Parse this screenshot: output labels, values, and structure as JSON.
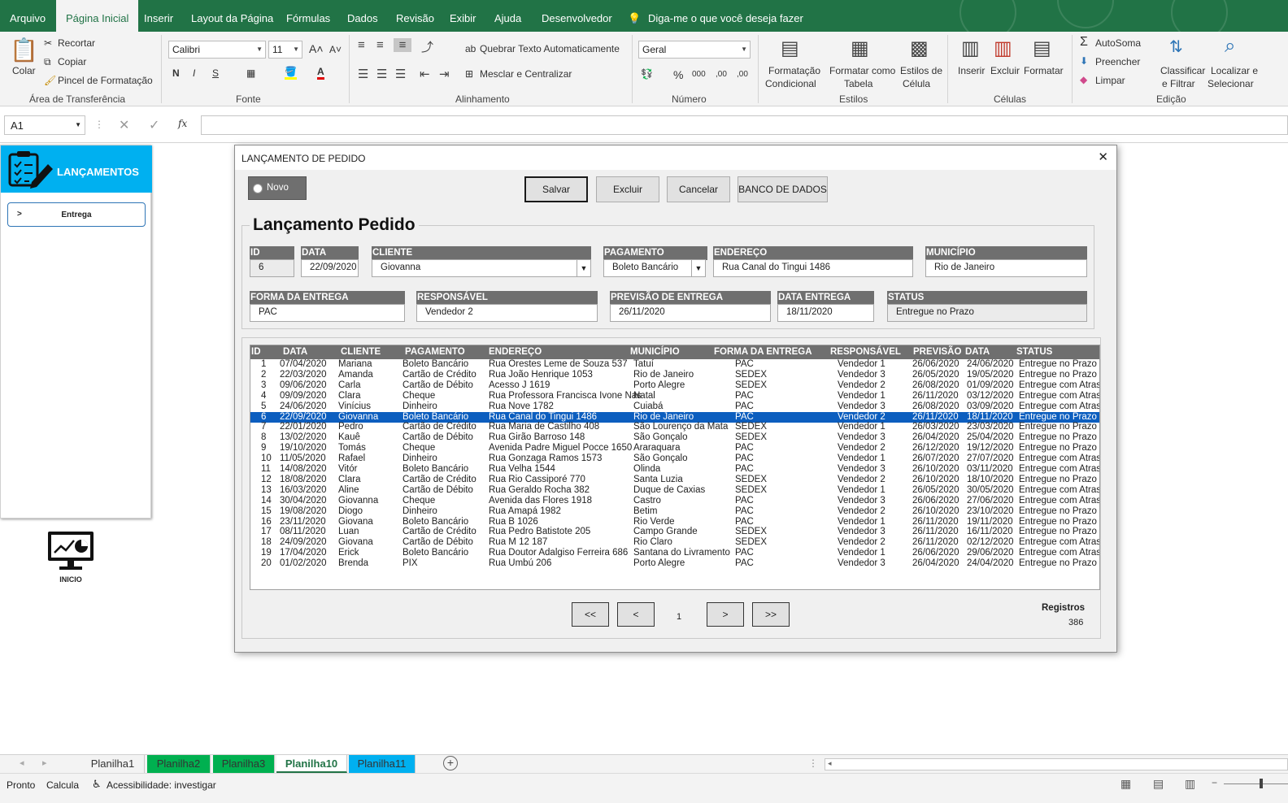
{
  "ribbon_tabs": [
    "Arquivo",
    "Página Inicial",
    "Inserir",
    "Layout da Página",
    "Fórmulas",
    "Dados",
    "Revisão",
    "Exibir",
    "Ajuda",
    "Desenvolvedor",
    "Diga-me o que você deseja fazer"
  ],
  "ribbon": {
    "clipboard": {
      "paste": "Colar",
      "cut": "Recortar",
      "copy": "Copiar",
      "format_painter": "Pincel de Formatação",
      "group": "Área de Transferência"
    },
    "font": {
      "name": "Calibri",
      "size": "11",
      "bold": "N",
      "italic": "I",
      "underline": "S",
      "group": "Fonte"
    },
    "alignment": {
      "wrap": "Quebrar Texto Automaticamente",
      "merge": "Mesclar e Centralizar",
      "group": "Alinhamento"
    },
    "number": {
      "format": "Geral",
      "percent": "%",
      "thousands": "000",
      "inc_dec": ",00",
      "dec_dec": ",00",
      "group": "Número"
    },
    "styles": {
      "conditional_1": "Formatação",
      "conditional_2": "Condicional",
      "format_table_1": "Formatar como",
      "format_table_2": "Tabela",
      "cell_styles_1": "Estilos de",
      "cell_styles_2": "Célula",
      "group": "Estilos"
    },
    "cells": {
      "insert": "Inserir",
      "delete": "Excluir",
      "format": "Formatar",
      "group": "Células"
    },
    "editing": {
      "autosum": "AutoSoma",
      "fill": "Preencher",
      "clear": "Limpar",
      "sort_1": "Classificar",
      "sort_2": "e Filtrar",
      "find_1": "Localizar e",
      "find_2": "Selecionar",
      "group": "Edição"
    }
  },
  "formula_bar": {
    "name_box": "A1",
    "fx": "fx",
    "value": ""
  },
  "side_panel": {
    "title": "LANÇAMENTOS",
    "button": "Entrega",
    "button_arrow": ">",
    "home_label": "INICIO"
  },
  "dialog": {
    "title": "LANÇAMENTO DE PEDIDO",
    "close": "✕",
    "new_option": "Novo",
    "buttons": {
      "save": "Salvar",
      "delete": "Excluir",
      "cancel": "Cancelar",
      "database": "BANCO DE DADOS"
    },
    "section_title": "Lançamento Pedido",
    "labels": {
      "id": "ID",
      "date": "DATA",
      "client": "CLIENTE",
      "payment": "PAGAMENTO",
      "address": "ENDEREÇO",
      "city": "MUNICÍPIO",
      "delivery": "FORMA DA ENTREGA",
      "responsible": "RESPONSÁVEL",
      "forecast": "PREVISÃO DE ENTREGA",
      "delivery_date": "DATA ENTREGA",
      "status": "STATUS"
    },
    "values": {
      "id": "6",
      "date": "22/09/2020",
      "client": "Giovanna",
      "payment": "Boleto Bancário",
      "address": "Rua Canal do Tingui 1486",
      "city": "Rio de Janeiro",
      "delivery": "PAC",
      "responsible": "Vendedor 2",
      "forecast": "26/11/2020",
      "delivery_date": "18/11/2020",
      "status": "Entregue no Prazo"
    },
    "list_headers": [
      "ID",
      "DATA",
      "CLIENTE",
      "PAGAMENTO",
      "ENDEREÇO",
      "MUNICÍPIO",
      "FORMA DA ENTREGA",
      "RESPONSÁVEL",
      "PREVISÃO",
      "DATA",
      "STATUS"
    ],
    "rows": [
      [
        "1",
        "07/04/2020",
        "Mariana",
        "Boleto Bancário",
        "Rua Orestes Leme de Souza 537",
        "Tatuí",
        "PAC",
        "Vendedor 1",
        "26/06/2020",
        "24/06/2020",
        "Entregue no Prazo"
      ],
      [
        "2",
        "22/03/2020",
        "Amanda",
        "Cartão de Crédito",
        "Rua João Henrique 1053",
        "Rio de Janeiro",
        "SEDEX",
        "Vendedor 3",
        "26/05/2020",
        "19/05/2020",
        "Entregue no Prazo"
      ],
      [
        "3",
        "09/06/2020",
        "Carla",
        "Cartão de Débito",
        "Acesso J 1619",
        "Porto Alegre",
        "SEDEX",
        "Vendedor 2",
        "26/08/2020",
        "01/09/2020",
        "Entregue com Atraso"
      ],
      [
        "4",
        "09/09/2020",
        "Clara",
        "Cheque",
        "Rua Professora Francisca Ivone Nas",
        "Natal",
        "PAC",
        "Vendedor 1",
        "26/11/2020",
        "03/12/2020",
        "Entregue com Atraso"
      ],
      [
        "5",
        "24/06/2020",
        "Vinícius",
        "Dinheiro",
        "Rua Nove 1782",
        "Cuiabá",
        "PAC",
        "Vendedor 3",
        "26/08/2020",
        "03/09/2020",
        "Entregue com Atraso"
      ],
      [
        "6",
        "22/09/2020",
        "Giovanna",
        "Boleto Bancário",
        "Rua Canal do Tingui 1486",
        "Rio de Janeiro",
        "PAC",
        "Vendedor 2",
        "26/11/2020",
        "18/11/2020",
        "Entregue no Prazo"
      ],
      [
        "7",
        "22/01/2020",
        "Pedro",
        "Cartão de Crédito",
        "Rua Maria de Castilho 408",
        "São Lourenço da Mata",
        "SEDEX",
        "Vendedor 1",
        "26/03/2020",
        "23/03/2020",
        "Entregue no Prazo"
      ],
      [
        "8",
        "13/02/2020",
        "Kauê",
        "Cartão de Débito",
        "Rua Girão Barroso 148",
        "São Gonçalo",
        "SEDEX",
        "Vendedor 3",
        "26/04/2020",
        "25/04/2020",
        "Entregue no Prazo"
      ],
      [
        "9",
        "19/10/2020",
        "Tomás",
        "Cheque",
        "Avenida Padre Miguel Pocce 1650",
        "Araraquara",
        "PAC",
        "Vendedor 2",
        "26/12/2020",
        "19/12/2020",
        "Entregue no Prazo"
      ],
      [
        "10",
        "11/05/2020",
        "Rafael",
        "Dinheiro",
        "Rua Gonzaga Ramos 1573",
        "São Gonçalo",
        "PAC",
        "Vendedor 1",
        "26/07/2020",
        "27/07/2020",
        "Entregue com Atraso"
      ],
      [
        "11",
        "14/08/2020",
        "Vitór",
        "Boleto Bancário",
        "Rua Velha 1544",
        "Olinda",
        "PAC",
        "Vendedor 3",
        "26/10/2020",
        "03/11/2020",
        "Entregue com Atraso"
      ],
      [
        "12",
        "18/08/2020",
        "Clara",
        "Cartão de Crédito",
        "Rua Rio Cassiporé 770",
        "Santa Luzia",
        "SEDEX",
        "Vendedor 2",
        "26/10/2020",
        "18/10/2020",
        "Entregue no Prazo"
      ],
      [
        "13",
        "16/03/2020",
        "Aline",
        "Cartão de Débito",
        "Rua Geraldo Rocha 382",
        "Duque de Caxias",
        "SEDEX",
        "Vendedor 1",
        "26/05/2020",
        "30/05/2020",
        "Entregue com Atraso"
      ],
      [
        "14",
        "30/04/2020",
        "Giovanna",
        "Cheque",
        "Avenida das Flores 1918",
        "Castro",
        "PAC",
        "Vendedor 3",
        "26/06/2020",
        "27/06/2020",
        "Entregue com Atraso"
      ],
      [
        "15",
        "19/08/2020",
        "Diogo",
        "Dinheiro",
        "Rua Amapá 1982",
        "Betim",
        "PAC",
        "Vendedor 2",
        "26/10/2020",
        "23/10/2020",
        "Entregue no Prazo"
      ],
      [
        "16",
        "23/11/2020",
        "Giovana",
        "Boleto Bancário",
        "Rua B 1026",
        "Rio Verde",
        "PAC",
        "Vendedor 1",
        "26/11/2020",
        "19/11/2020",
        "Entregue no Prazo"
      ],
      [
        "17",
        "08/11/2020",
        "Luan",
        "Cartão de Crédito",
        "Rua Pedro Batistote 205",
        "Campo Grande",
        "SEDEX",
        "Vendedor 3",
        "26/11/2020",
        "16/11/2020",
        "Entregue no Prazo"
      ],
      [
        "18",
        "24/09/2020",
        "Giovana",
        "Cartão de Débito",
        "Rua M 12 187",
        "Rio Claro",
        "SEDEX",
        "Vendedor 2",
        "26/11/2020",
        "02/12/2020",
        "Entregue com Atraso"
      ],
      [
        "19",
        "17/04/2020",
        "Erick",
        "Boleto Bancário",
        "Rua Doutor Adalgiso Ferreira 686",
        "Santana do Livramento",
        "PAC",
        "Vendedor 1",
        "26/06/2020",
        "29/06/2020",
        "Entregue com Atraso"
      ],
      [
        "20",
        "01/02/2020",
        "Brenda",
        "PIX",
        "Rua Umbú 206",
        "Porto Alegre",
        "PAC",
        "Vendedor 3",
        "26/04/2020",
        "24/04/2020",
        "Entregue no Prazo"
      ]
    ],
    "selected_row": 6,
    "pager": {
      "first": "<<",
      "prev": "<",
      "page": "1",
      "next": ">",
      "last": ">>"
    },
    "records_label": "Registros",
    "records_count": "386"
  },
  "sheet_tabs": [
    {
      "name": "Planilha1",
      "color": "#f3f3f3"
    },
    {
      "name": "Planilha2",
      "color": "#00b050"
    },
    {
      "name": "Planilha3",
      "color": "#00b050"
    },
    {
      "name": "Planilha10",
      "color": "#ffffff"
    },
    {
      "name": "Planilha11",
      "color": "#00b0f0"
    }
  ],
  "status_bar": {
    "ready": "Pronto",
    "calc": "Calcula",
    "accessibility": "Acessibilidade: investigar"
  }
}
